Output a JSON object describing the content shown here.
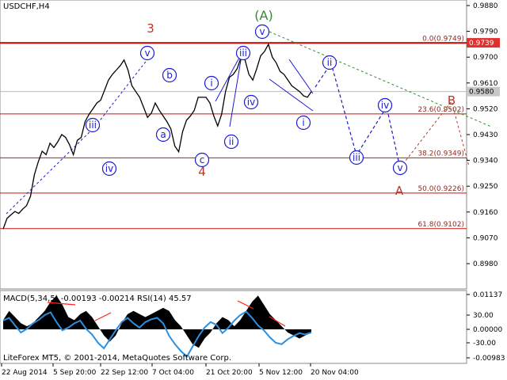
{
  "symbol_label": "USDCHF,H4",
  "footer": "LiteForex MT5, © 2001-2014, MetaQuotes Software Corp.",
  "indicator_label": "MACD(5,34,5) -0.00193 -0.00214 RSI(14) 45.57",
  "colors": {
    "price": "#000000",
    "wave_blue": "#1a1ad6",
    "wave_red": "#b5362e",
    "wave_green": "#2e8b2e",
    "fib_line": "#cc1111",
    "macd_signal": "#ff2020",
    "rsi": "#2a8fe0"
  },
  "chart_data": [
    {
      "type": "line",
      "title": "USDCHF,H4",
      "ylim": [
        0.9,
        0.988
      ],
      "y_ticks": [
        "0.9880",
        "0.9790",
        "0.9700",
        "0.9610",
        "0.9520",
        "0.9430",
        "0.9340",
        "0.9250",
        "0.9160",
        "0.9070",
        "0.8980"
      ],
      "x_ticks": [
        "22 Aug 2014",
        "5 Sep 20:00",
        "22 Sep 12:00",
        "7 Oct 04:00",
        "21 Oct 20:00",
        "5 Nov 12:00",
        "20 Nov 04:00"
      ],
      "current_price": "0.9580",
      "resistance_label": "0.9739",
      "fibonacci_levels": [
        {
          "label": "0.0(0.9749)",
          "value": 0.9749
        },
        {
          "label": "23.6(0.9502)",
          "value": 0.9502
        },
        {
          "label": "38.2(0.9349)",
          "value": 0.9349
        },
        {
          "label": "50.0(0.9226)",
          "value": 0.9226
        },
        {
          "label": "61.8(0.9102)",
          "value": 0.9102
        }
      ],
      "series": [
        {
          "x_index": [
            0,
            1,
            2,
            3,
            4,
            5,
            6,
            7,
            8,
            9,
            10,
            11,
            12,
            13,
            14,
            15,
            16,
            17,
            18,
            19,
            20,
            21,
            22,
            23,
            24,
            25,
            26,
            27,
            28,
            29,
            30,
            31,
            32,
            33,
            34,
            35,
            36,
            37,
            38,
            39,
            40,
            41,
            42,
            43,
            44,
            45,
            46,
            47,
            48,
            49,
            50,
            51,
            52,
            53,
            54,
            55,
            56,
            57,
            58,
            59,
            60,
            61,
            62,
            63,
            64,
            65,
            66,
            67,
            68,
            69,
            70,
            71,
            72,
            73,
            74,
            75,
            76,
            77,
            78,
            79
          ],
          "values": [
            0.9101,
            0.9138,
            0.915,
            0.9162,
            0.9155,
            0.917,
            0.9182,
            0.9215,
            0.929,
            0.9335,
            0.9372,
            0.936,
            0.94,
            0.9385,
            0.9405,
            0.943,
            0.942,
            0.9395,
            0.936,
            0.941,
            0.942,
            0.9475,
            0.95,
            0.952,
            0.954,
            0.955,
            0.9585,
            0.962,
            0.964,
            0.9655,
            0.967,
            0.969,
            0.9655,
            0.96,
            0.958,
            0.956,
            0.9525,
            0.949,
            0.9505,
            0.954,
            0.9515,
            0.9495,
            0.9475,
            0.945,
            0.939,
            0.937,
            0.944,
            0.948,
            0.9495,
            0.9515,
            0.956,
            0.956,
            0.956,
            0.954,
            0.9495,
            0.946,
            0.95,
            0.958,
            0.963,
            0.964,
            0.966,
            0.97,
            0.969,
            0.964,
            0.962,
            0.966,
            0.9705,
            0.972,
            0.9745,
            0.97,
            0.968,
            0.965,
            0.964,
            0.962,
            0.96,
            0.959,
            0.958,
            0.9565,
            0.956,
            0.958
          ]
        }
      ],
      "wave_labels_blue": [
        "iii",
        "iv",
        "v",
        "a",
        "b",
        "c",
        "i",
        "ii",
        "iii",
        "iv",
        "v",
        "i",
        "ii",
        "iii",
        "iv",
        "v"
      ],
      "wave_labels_red": [
        "3",
        "4",
        "B",
        "A"
      ],
      "wave_label_green": "(A)"
    },
    {
      "type": "line",
      "title": "MACD(5,34,5) -0.00193 -0.00214 RSI(14) 45.57",
      "y_ticks": [
        "0.01137",
        "30.00",
        "0.00000",
        "-30.00",
        "-0.00983"
      ],
      "series": [
        {
          "name": "MACD",
          "values": [
            0.003,
            0.006,
            0.004,
            0.002,
            0.001,
            0.002,
            0.004,
            0.006,
            0.009,
            0.011,
            0.008,
            0.004,
            0.003,
            0.005,
            0.006,
            0.004,
            0.001,
            -0.002,
            -0.004,
            -0.002,
            0.002,
            0.005,
            0.006,
            0.005,
            0.004,
            0.005,
            0.006,
            0.007,
            0.006,
            0.003,
            0.001,
            -0.002,
            -0.005,
            -0.006,
            -0.003,
            -0.001,
            0.002,
            0.004,
            0.003,
            0.001,
            0.003,
            0.006,
            0.009,
            0.011,
            0.008,
            0.005,
            0.003,
            0.001,
            -0.001,
            -0.002,
            -0.003,
            -0.002,
            -0.001
          ]
        },
        {
          "name": "RSI",
          "values": [
            62,
            66,
            55,
            45,
            50,
            58,
            63,
            70,
            74,
            60,
            48,
            52,
            58,
            62,
            50,
            42,
            30,
            22,
            35,
            48,
            60,
            66,
            58,
            52,
            60,
            64,
            66,
            58,
            40,
            28,
            18,
            10,
            25,
            40,
            52,
            60,
            56,
            44,
            52,
            62,
            70,
            75,
            66,
            55,
            48,
            38,
            30,
            28,
            35,
            40,
            44,
            42,
            45
          ]
        }
      ]
    }
  ]
}
